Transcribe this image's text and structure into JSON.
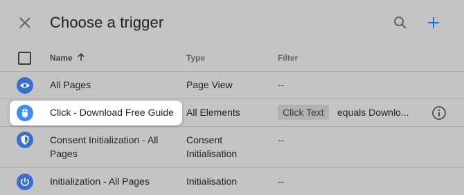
{
  "header": {
    "title": "Choose a trigger",
    "close_icon": "close-icon",
    "search_icon": "search-icon",
    "add_icon": "add-icon"
  },
  "columns": {
    "name": "Name",
    "type": "Type",
    "filter": "Filter",
    "sort_icon": "arrow-up-icon"
  },
  "rows": [
    {
      "name": "All Pages",
      "type": "Page View",
      "filter": "--",
      "icon": "eye-icon"
    },
    {
      "name": "Click - Download Free Guide",
      "type": "All Elements",
      "filter_chip": "Click Text",
      "filter_rest": "equals Downlo...",
      "icon": "mouse-icon",
      "info_icon": "info-icon",
      "highlighted": true
    },
    {
      "name": "Consent Initialization - All Pages",
      "type": "Consent Initialisation",
      "filter": "--",
      "icon": "shield-icon"
    },
    {
      "name": "Initialization - All Pages",
      "type": "Initialisation",
      "filter": "--",
      "icon": "power-icon"
    }
  ],
  "colors": {
    "background": "#c4c4c4",
    "icon_blue": "#3a6fd1",
    "accent_add": "#1a73e8"
  }
}
